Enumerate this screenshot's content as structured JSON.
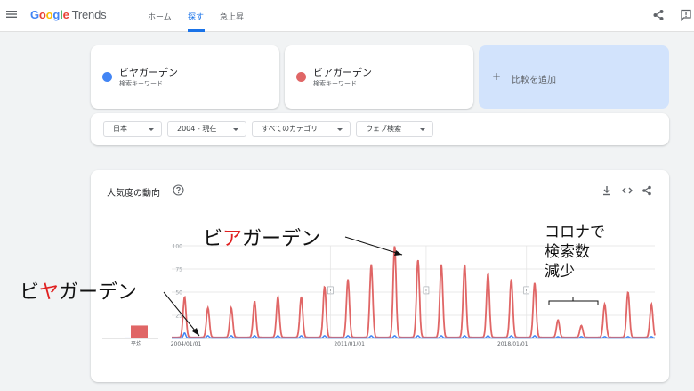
{
  "header": {
    "logo": {
      "google": "Google",
      "trends": "Trends"
    },
    "nav": [
      {
        "label": "ホーム",
        "active": false
      },
      {
        "label": "探す",
        "active": true
      },
      {
        "label": "急上昇",
        "active": false
      }
    ]
  },
  "compare": {
    "terms": [
      {
        "title": "ビヤガーデン",
        "subtitle": "検索キーワード",
        "color": "#4285f4"
      },
      {
        "title": "ビアガーデン",
        "subtitle": "検索キーワード",
        "color": "#e06666"
      }
    ],
    "add_label": "比較を追加"
  },
  "filters": [
    {
      "label": "日本"
    },
    {
      "label": "2004 - 現在"
    },
    {
      "label": "すべてのカテゴリ"
    },
    {
      "label": "ウェブ検索"
    }
  ],
  "chart": {
    "title": "人気度の動向",
    "average_label": "平均",
    "note_marker": "!"
  },
  "chart_data": {
    "type": "line",
    "title": "人気度の動向",
    "xlabel": "",
    "ylabel": "",
    "ylim": [
      0,
      100
    ],
    "yticks": [
      "100",
      "75",
      "50",
      "25"
    ],
    "xticks": [
      "2004/01/01",
      "2011/01/01",
      "2018/01/01"
    ],
    "x_range": [
      "2004",
      "2024.7"
    ],
    "grid": true,
    "averages": {
      "ビヤガーデン": 1,
      "ビアガーデン": 14
    },
    "series": [
      {
        "name": "ビアガーデン",
        "color": "#e06666",
        "annual_peaks": [
          {
            "year": 2004,
            "value": 45
          },
          {
            "year": 2005,
            "value": 33
          },
          {
            "year": 2006,
            "value": 33
          },
          {
            "year": 2007,
            "value": 40
          },
          {
            "year": 2008,
            "value": 45
          },
          {
            "year": 2009,
            "value": 45
          },
          {
            "year": 2010,
            "value": 56
          },
          {
            "year": 2011,
            "value": 64
          },
          {
            "year": 2012,
            "value": 80
          },
          {
            "year": 2013,
            "value": 100
          },
          {
            "year": 2014,
            "value": 85
          },
          {
            "year": 2015,
            "value": 80
          },
          {
            "year": 2016,
            "value": 80
          },
          {
            "year": 2017,
            "value": 70
          },
          {
            "year": 2018,
            "value": 64
          },
          {
            "year": 2019,
            "value": 60
          },
          {
            "year": 2020,
            "value": 20
          },
          {
            "year": 2021,
            "value": 14
          },
          {
            "year": 2022,
            "value": 37
          },
          {
            "year": 2023,
            "value": 50
          },
          {
            "year": 2024,
            "value": 37
          }
        ]
      },
      {
        "name": "ビヤガーデン",
        "color": "#4285f4",
        "annual_peaks": [
          {
            "year": 2004,
            "value": 6
          },
          {
            "year": 2005,
            "value": 3
          },
          {
            "year": 2006,
            "value": 3
          },
          {
            "year": 2007,
            "value": 3
          },
          {
            "year": 2008,
            "value": 3
          },
          {
            "year": 2009,
            "value": 3
          },
          {
            "year": 2010,
            "value": 3
          },
          {
            "year": 2011,
            "value": 3
          },
          {
            "year": 2012,
            "value": 3
          },
          {
            "year": 2013,
            "value": 3
          },
          {
            "year": 2014,
            "value": 3
          },
          {
            "year": 2015,
            "value": 3
          },
          {
            "year": 2016,
            "value": 3
          },
          {
            "year": 2017,
            "value": 3
          },
          {
            "year": 2018,
            "value": 3
          },
          {
            "year": 2019,
            "value": 3
          },
          {
            "year": 2020,
            "value": 2
          },
          {
            "year": 2021,
            "value": 2
          },
          {
            "year": 2022,
            "value": 2
          },
          {
            "year": 2023,
            "value": 2
          },
          {
            "year": 2024,
            "value": 2
          }
        ]
      }
    ]
  },
  "annotations": {
    "peak_label_pre": "ビ",
    "peak_label_red": "ア",
    "peak_label_post": "ガーデン",
    "low_label_pre": "ビ",
    "low_label_red": "ヤ",
    "low_label_post": "ガーデン",
    "covid_line1": "コロナで",
    "covid_line2": "検索数",
    "covid_line3": "減少"
  }
}
